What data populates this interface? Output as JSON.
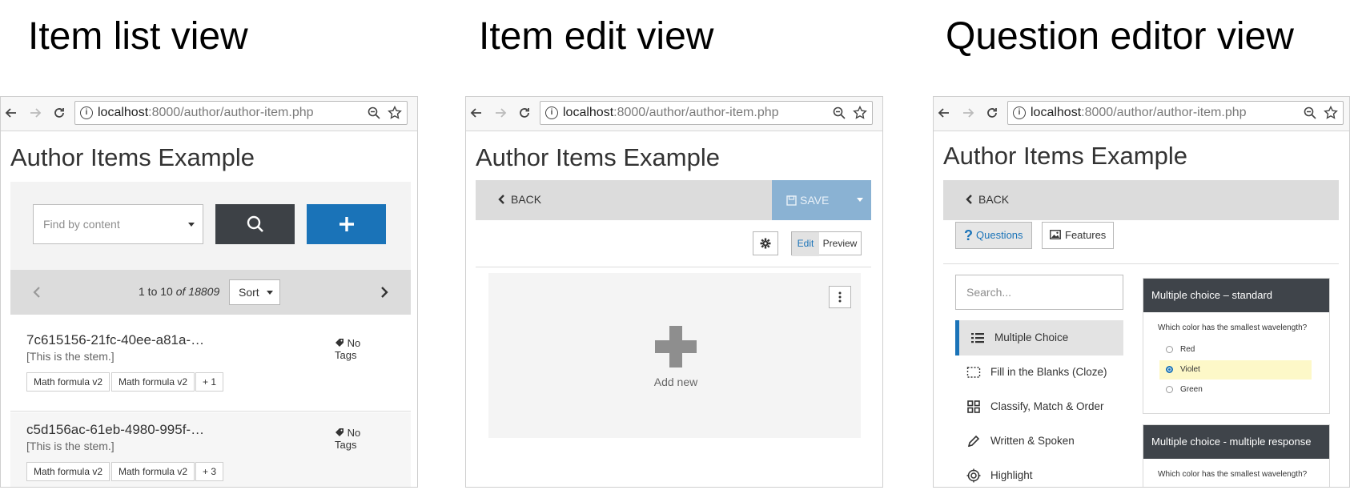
{
  "views": [
    {
      "title": "Item list view"
    },
    {
      "title": "Item edit view"
    },
    {
      "title": "Question editor view"
    }
  ],
  "browser": {
    "url_host": "localhost",
    "url_path": ":8000/author/author-item.php"
  },
  "page_title": "Author Items Example",
  "list_view": {
    "search_placeholder": "Find by content",
    "pager_range": "1 to 10",
    "pager_of": "of",
    "pager_total": "18809",
    "sort_label": "Sort",
    "items": [
      {
        "id": "7c615156-21fc-40ee-a81a-…",
        "stem": "[This is the stem.]",
        "tags_label": "No Tags",
        "tags": [
          "Math formula v2",
          "Math formula v2",
          "+ 1"
        ]
      },
      {
        "id": "c5d156ac-61eb-4980-995f-…",
        "stem": "[This is the stem.]",
        "tags_label": "No Tags",
        "tags": [
          "Math formula v2",
          "Math formula v2",
          "+ 3"
        ]
      }
    ]
  },
  "edit_view": {
    "back_label": "BACK",
    "save_label": "SAVE",
    "edit_label": "Edit",
    "preview_label": "Preview",
    "add_new_label": "Add new"
  },
  "question_view": {
    "back_label": "BACK",
    "questions_tab": "Questions",
    "features_tab": "Features",
    "search_placeholder": "Search...",
    "types": [
      {
        "label": "Multiple Choice",
        "icon": "list-icon"
      },
      {
        "label": "Fill in the Blanks (Cloze)",
        "icon": "dashed-box-icon"
      },
      {
        "label": "Classify, Match & Order",
        "icon": "grid-icon"
      },
      {
        "label": "Written & Spoken",
        "icon": "pencil-icon"
      },
      {
        "label": "Highlight",
        "icon": "target-icon"
      }
    ],
    "cards": [
      {
        "title": "Multiple choice – standard",
        "question": "Which color has the smallest wavelength?",
        "options": [
          "Red",
          "Violet",
          "Green"
        ],
        "selected": "Violet"
      },
      {
        "title": "Multiple choice - multiple response",
        "question": "Which color has the smallest wavelength?"
      }
    ]
  },
  "colors": {
    "accent": "#1a73b8",
    "dark_button": "#3d4146",
    "save_disabled": "#8ab2d3",
    "highlight_option": "#fdf8c8"
  }
}
